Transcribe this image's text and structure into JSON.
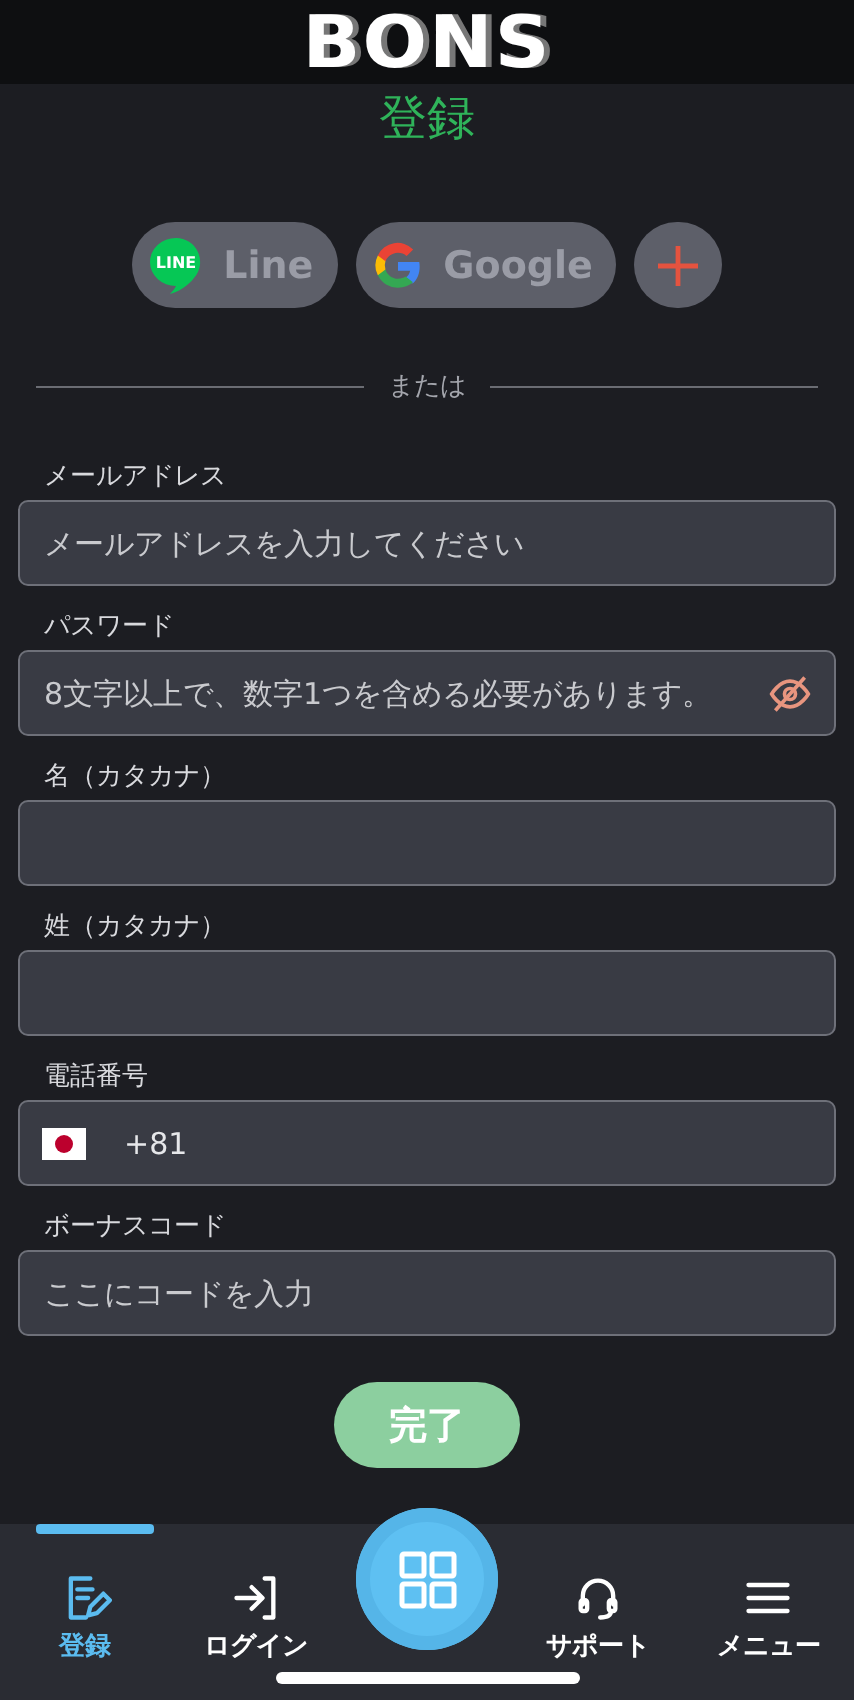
{
  "header": {
    "logo": "BONS"
  },
  "title": "登録",
  "social_buttons": [
    {
      "kind": "line",
      "label": "Line",
      "badge": "LINE"
    },
    {
      "kind": "google",
      "label": "Google"
    },
    {
      "kind": "more"
    }
  ],
  "divider_text": "または",
  "fields": [
    {
      "kind": "text",
      "label": "メールアドレス",
      "placeholder": "メールアドレスを入力してください"
    },
    {
      "kind": "password",
      "label": "パスワード",
      "placeholder": "8文字以上で、数字1つを含める必要があります。"
    },
    {
      "kind": "text",
      "label": "名（カタカナ）"
    },
    {
      "kind": "text",
      "label": "姓（カタカナ）"
    },
    {
      "kind": "phone",
      "label": "電話番号",
      "value": "+81"
    },
    {
      "kind": "text",
      "label": "ボーナスコード",
      "placeholder": "ここにコードを入力"
    }
  ],
  "submit_button": "完了",
  "bottom_nav": [
    {
      "kind": "register",
      "label": "登録",
      "selected": true
    },
    {
      "kind": "login",
      "label": "ログイン",
      "selected": false
    },
    {
      "kind": "support",
      "label": "サポート",
      "selected": false
    },
    {
      "kind": "menu",
      "label": "メニュー",
      "selected": false
    }
  ]
}
